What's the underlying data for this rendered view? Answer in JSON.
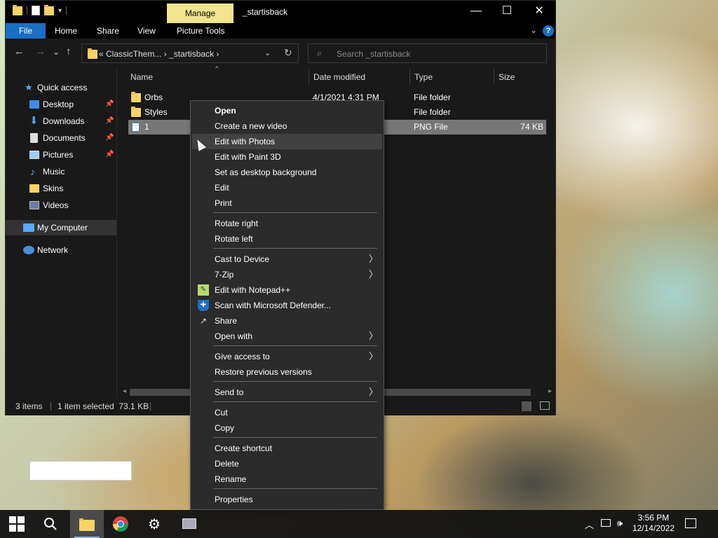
{
  "window": {
    "title": "_startisback",
    "manage_tab": "Manage",
    "ribbon_tabs": [
      "File",
      "Home",
      "Share",
      "View",
      "Picture Tools"
    ],
    "caption_minimize": "—",
    "caption_maximize": "☐",
    "caption_close": "✕",
    "help_icon": "?"
  },
  "nav": {
    "back": "←",
    "forward": "→",
    "recent": "⌄",
    "up": "↑",
    "address": "«  ClassicThem...  ›  _startisback  ›",
    "search_placeholder": "Search _startisback"
  },
  "sidebar": {
    "items": [
      {
        "label": "Quick access",
        "icon": "star-icon",
        "pinned": false
      },
      {
        "label": "Desktop",
        "icon": "desktop-icon",
        "pinned": true
      },
      {
        "label": "Downloads",
        "icon": "download-icon",
        "pinned": true
      },
      {
        "label": "Documents",
        "icon": "documents-icon",
        "pinned": true
      },
      {
        "label": "Pictures",
        "icon": "pictures-icon",
        "pinned": true
      },
      {
        "label": "Music",
        "icon": "music-icon",
        "pinned": false
      },
      {
        "label": "Skins",
        "icon": "folder-icon",
        "pinned": false
      },
      {
        "label": "Videos",
        "icon": "videos-icon",
        "pinned": false
      },
      {
        "label": "My Computer",
        "icon": "computer-icon",
        "pinned": false
      },
      {
        "label": "Network",
        "icon": "network-icon",
        "pinned": false
      }
    ]
  },
  "columns": [
    "Name",
    "Date modified",
    "Type",
    "Size"
  ],
  "files": [
    {
      "name": "Orbs",
      "date": "4/1/2021 4:31 PM",
      "type": "File folder",
      "size": ""
    },
    {
      "name": "Styles",
      "date": "",
      "type": "File folder",
      "size": ""
    },
    {
      "name": "1",
      "date": "",
      "type": "PNG File",
      "size": "74 KB"
    }
  ],
  "status": {
    "count": "3 items",
    "selected": "1 item selected  73.1 KB"
  },
  "context_menu": {
    "items": [
      "Open",
      "Create a new video",
      "Edit with Photos",
      "Edit with Paint 3D",
      "Set as desktop background",
      "Edit",
      "Print",
      "Rotate right",
      "Rotate left",
      "Cast to Device",
      "7-Zip",
      "Edit with Notepad++",
      "Scan with Microsoft Defender...",
      "Share",
      "Open with",
      "Give access to",
      "Restore previous versions",
      "Send to",
      "Cut",
      "Copy",
      "Create shortcut",
      "Delete",
      "Rename",
      "Properties"
    ],
    "highlighted": "Edit with Photos"
  },
  "taskbar": {
    "time": "3:56 PM",
    "date": "12/14/2022"
  },
  "colors": {
    "accent": "#1a6fc4",
    "manage_tab": "#f2e58f",
    "window_bg": "#191919",
    "menu_bg": "#2b2b2b"
  }
}
